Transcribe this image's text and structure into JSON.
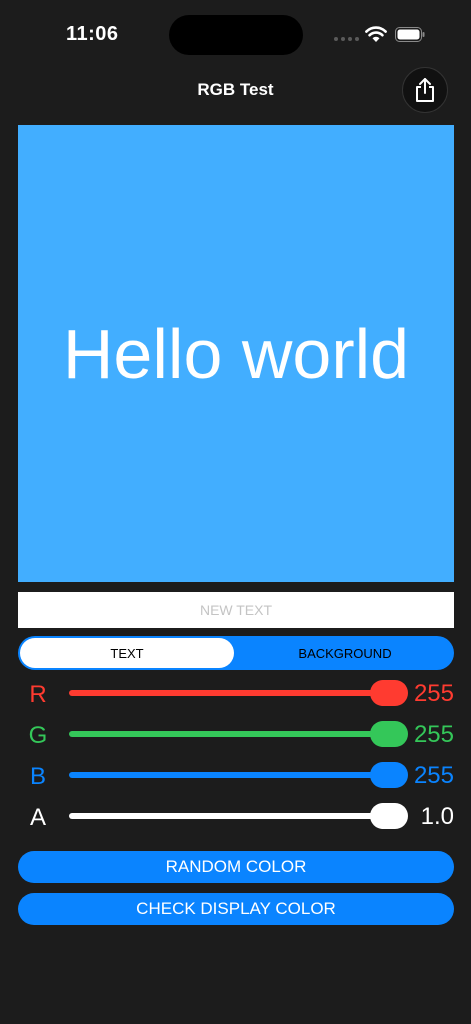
{
  "status_bar": {
    "time": "11:06"
  },
  "nav": {
    "title": "RGB Test"
  },
  "preview": {
    "text": "Hello world",
    "text_color": "#ffffff",
    "background_color": "#42aeff"
  },
  "text_input": {
    "value": "",
    "placeholder": "NEW TEXT"
  },
  "segmented": {
    "selected": "text",
    "options": [
      {
        "label": "TEXT"
      },
      {
        "label": "BACKGROUND"
      }
    ]
  },
  "sliders": [
    {
      "label": "R",
      "value": 255,
      "display": "255",
      "color": "#ff3b30",
      "max": 255
    },
    {
      "label": "G",
      "value": 255,
      "display": "255",
      "color": "#34c759",
      "max": 255
    },
    {
      "label": "B",
      "value": 255,
      "display": "255",
      "color": "#0a84ff",
      "max": 255
    },
    {
      "label": "A",
      "value": 1.0,
      "display": "1.0",
      "color": "#ffffff",
      "max": 1.0
    }
  ],
  "buttons": {
    "random": "RANDOM COLOR",
    "check": "CHECK DISPLAY COLOR"
  },
  "colors": {
    "accent": "#0a84ff",
    "background": "#1c1c1c"
  }
}
